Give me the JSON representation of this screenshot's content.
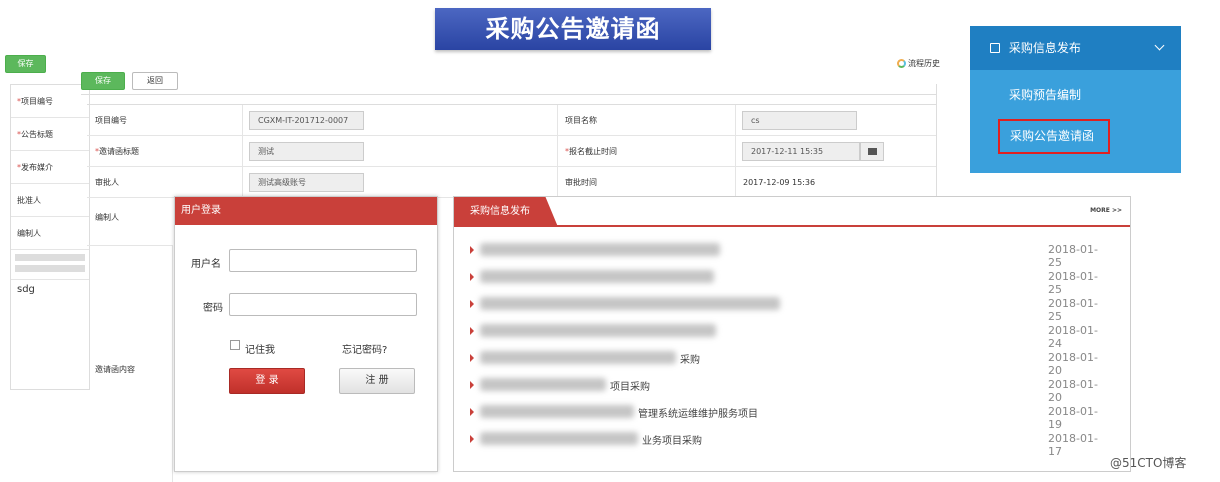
{
  "banner": {
    "title": "采购公告邀请函"
  },
  "outer_toolbar": {
    "save": "保存"
  },
  "toolbar": {
    "save": "保存",
    "back": "返回",
    "flow_history": "流程历史"
  },
  "back_form": {
    "rows": [
      "项目编号",
      "公告标题",
      "发布媒介",
      "批准人",
      "编制人"
    ],
    "editor_text": "sdg"
  },
  "form": {
    "project_no_label": "项目编号",
    "project_no_value": "CGXM-IT-201712-0007",
    "project_name_label": "项目名称",
    "project_name_value": "cs",
    "invite_title_label": "邀请函标题",
    "invite_title_value": "测试",
    "deadline_label": "报名截止时间",
    "deadline_value": "2017-12-11 15:35",
    "approver_label": "审批人",
    "approver_value": "测试高级账号",
    "approve_time_label": "审批时间",
    "approve_time_value": "2017-12-09 15:36",
    "compiler_label": "编制人",
    "content_label": "邀请函内容"
  },
  "login": {
    "title": "用户登录",
    "username_label": "用户名",
    "password_label": "密码",
    "remember": "记住我",
    "forgot": "忘记密码?",
    "login_btn": "登 录",
    "register_btn": "注 册"
  },
  "news": {
    "tab": "采购信息发布",
    "more": "more >>",
    "items": [
      {
        "text": "",
        "date": "2018-01-25"
      },
      {
        "text": "",
        "date": "2018-01-25"
      },
      {
        "text": "",
        "date": "2018-01-25"
      },
      {
        "text": "",
        "date": "2018-01-24"
      },
      {
        "text": "采购",
        "date": "2018-01-20"
      },
      {
        "text": "项目采购",
        "date": "2018-01-20"
      },
      {
        "text": "管理系统运维维护服务项目",
        "date": "2018-01-19"
      },
      {
        "text": "业务项目采购",
        "date": "2018-01-17"
      }
    ]
  },
  "menu": {
    "header": "采购信息发布",
    "items": [
      "采购预告编制",
      "采购公告邀请函"
    ],
    "highlight_color": "#e02020"
  },
  "watermark": "@51CTO博客"
}
